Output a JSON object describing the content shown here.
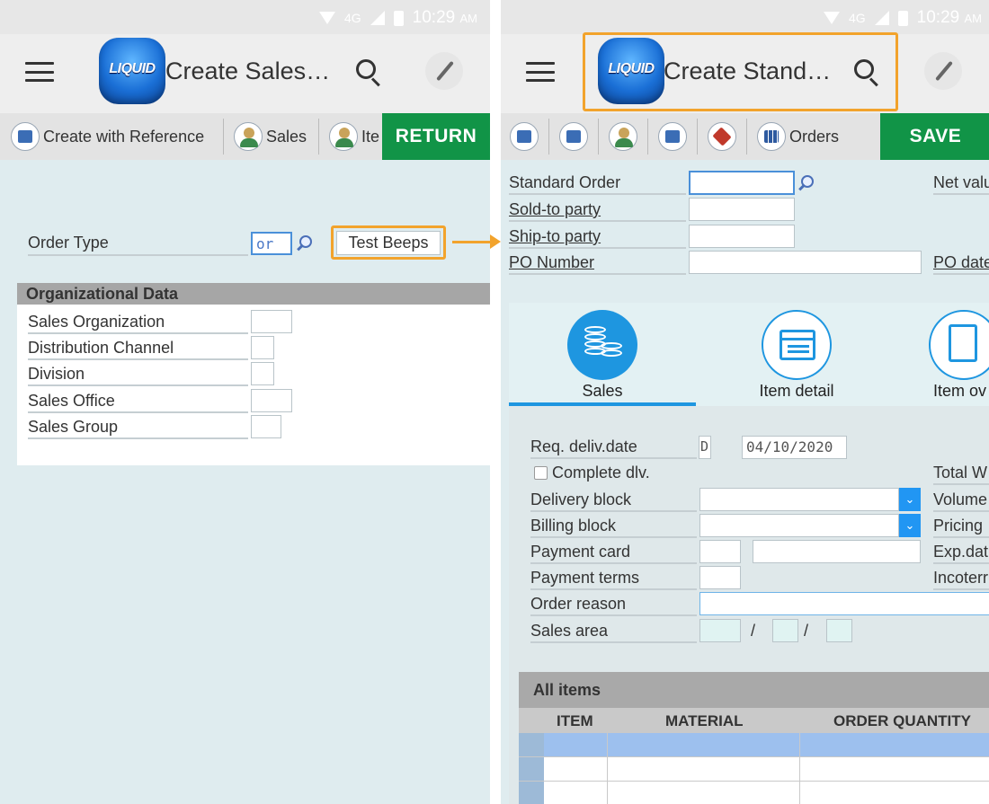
{
  "status_bar": {
    "network": "4G",
    "time": "10:29",
    "ampm": "AM"
  },
  "left_screen": {
    "logo_text": "LIQUID",
    "title": "Create Sales…",
    "toolbar": {
      "create_with_reference": "Create with Reference",
      "sales": "Sales",
      "item": "Ite",
      "return_label": "RETURN"
    },
    "order_type_label": "Order Type",
    "order_type_value": "or",
    "test_beeps_label": "Test Beeps",
    "org_section_title": "Organizational Data",
    "org_fields": [
      "Sales Organization",
      "Distribution Channel",
      "Division",
      "Sales Office",
      "Sales Group"
    ]
  },
  "right_screen": {
    "logo_text": "LIQUID",
    "title": "Create Stand…",
    "toolbar": {
      "orders": "Orders",
      "save_label": "SAVE"
    },
    "header_fields": {
      "standard_order": "Standard Order",
      "sold_to": "Sold-to party",
      "ship_to": "Ship-to party",
      "po_number": "PO Number",
      "net_value": "Net valu",
      "po_date": "PO date"
    },
    "tabs": [
      {
        "label": "Sales",
        "icon": "coins-icon"
      },
      {
        "label": "Item detail",
        "icon": "window-icon"
      },
      {
        "label": "Item ov",
        "icon": "document-icon"
      }
    ],
    "sales_form": {
      "req_deliv_date_label": "Req. deliv.date",
      "date_format": "D",
      "req_deliv_date_value": "04/10/2020",
      "complete_dlv_label": "Complete dlv.",
      "delivery_block_label": "Delivery block",
      "billing_block_label": "Billing block",
      "payment_card_label": "Payment card",
      "payment_terms_label": "Payment terms",
      "order_reason_label": "Order reason",
      "sales_area_label": "Sales area",
      "sales_area_sep": "/",
      "right_labels": [
        "Total W",
        "Volume",
        "Pricing",
        "Exp.dat",
        "Incoterr"
      ]
    },
    "items_table": {
      "title": "All items",
      "columns": [
        "ITEM",
        "MATERIAL",
        "ORDER QUANTITY"
      ]
    }
  },
  "colors": {
    "accent": "#1e96e0",
    "green": "#119447",
    "highlight": "#f2a32c"
  }
}
